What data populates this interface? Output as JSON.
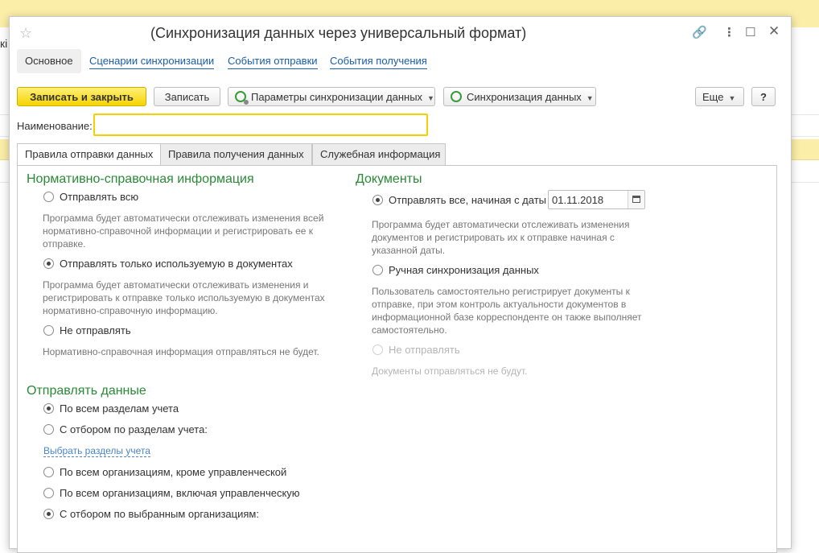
{
  "background": {
    "left_text": "кі"
  },
  "window": {
    "title": "(Синхронизация данных через универсальный формат)",
    "nav_tabs": [
      {
        "label": "Основное"
      },
      {
        "label": "Сценарии синхронизации"
      },
      {
        "label": "События отправки"
      },
      {
        "label": "События получения"
      }
    ]
  },
  "toolbar": {
    "save_close_label": "Записать и закрыть",
    "save_label": "Записать",
    "sync_params_label": "Параметры синхронизации данных",
    "sync_data_label": "Синхронизация данных",
    "more_label": "Еще",
    "help_label": "?"
  },
  "name_field": {
    "label": "Наименование:",
    "value": ""
  },
  "content_tabs": [
    {
      "label": "Правила отправки данных"
    },
    {
      "label": "Правила получения данных"
    },
    {
      "label": "Служебная информация"
    }
  ],
  "nsi": {
    "title": "Нормативно-справочная информация",
    "opt_all": "Отправлять всю",
    "desc_all": [
      "Программа будет автоматически отслеживать изменения всей",
      "нормативно-справочной информации и регистрировать ее к",
      "отправке."
    ],
    "opt_used": "Отправлять только используемую в документах",
    "desc_used": [
      "Программа будет автоматически отслеживать изменения и",
      "регистрировать к отправке только используемую в документах",
      "нормативно-справочную информацию."
    ],
    "opt_none": "Не отправлять",
    "desc_none": "Нормативно-справочная информация отправляться не будет."
  },
  "docs": {
    "title": "Документы",
    "opt_from_date": "Отправлять все, начиная с даты",
    "date_value": "01.11.2018",
    "desc_from_date": [
      "Программа будет автоматически отслеживать изменения",
      "документов и регистрировать их к отправке начиная с",
      "указанной даты."
    ],
    "opt_manual": "Ручная синхронизация данных",
    "desc_manual": [
      "Пользователь самостоятельно регистрирует документы к",
      "отправке, при этом контроль актуальности документов в",
      "информационной базе корреспонденте он также выполняет",
      "самостоятельно."
    ],
    "opt_none": "Не отправлять",
    "desc_none": "Документы отправляться не будут."
  },
  "send_data": {
    "title": "Отправлять данные",
    "opt_all_sections": "По всем разделам учета",
    "opt_filter_sections": "С отбором по разделам учета:",
    "choose_sections_link": "Выбрать разделы учета",
    "opt_orgs_except": "По всем организациям, кроме управленческой",
    "opt_orgs_incl": "По всем организациям, включая управленческую",
    "opt_orgs_selected": "С отбором по выбранным организациям:"
  }
}
